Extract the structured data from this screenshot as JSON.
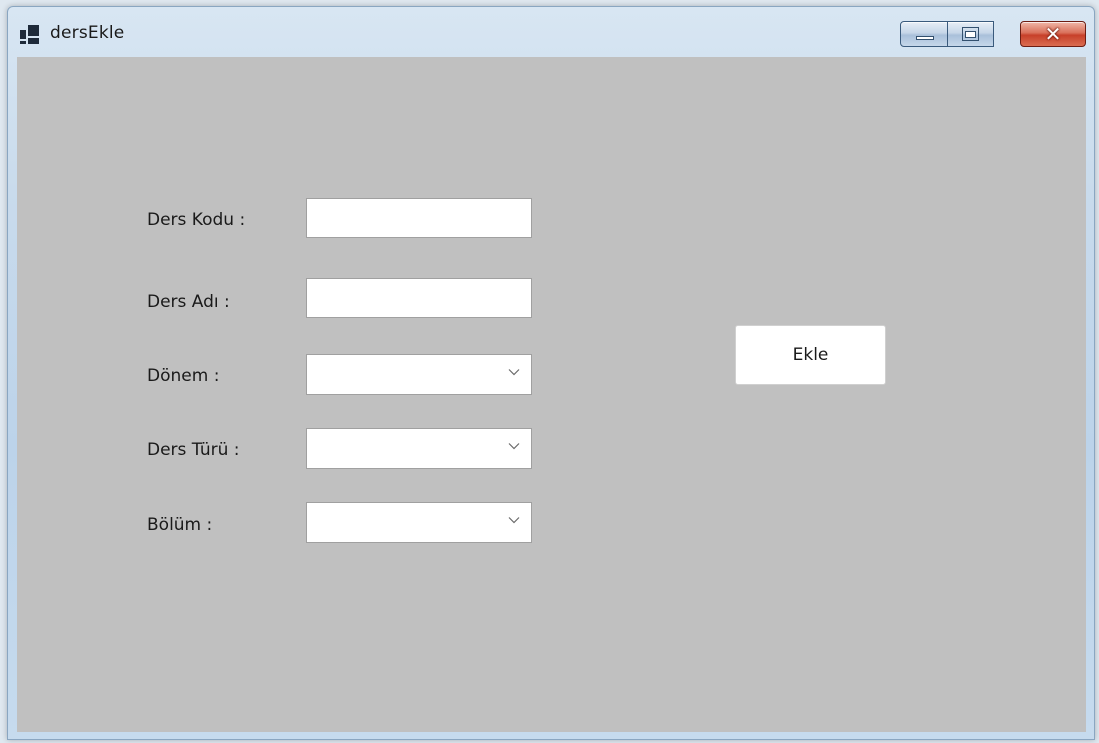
{
  "window": {
    "title": "dersEkle",
    "icon": "app-window-icon",
    "controls": {
      "minimize": "minimize-icon",
      "maximize": "maximize-icon",
      "close": "close-icon"
    }
  },
  "form": {
    "fields": [
      {
        "label": "Ders Kodu :",
        "type": "textbox",
        "value": ""
      },
      {
        "label": "Ders Adı :",
        "type": "textbox",
        "value": ""
      },
      {
        "label": "Dönem :",
        "type": "combobox",
        "value": ""
      },
      {
        "label": "Ders Türü :",
        "type": "combobox",
        "value": ""
      },
      {
        "label": "Bölüm :",
        "type": "combobox",
        "value": ""
      }
    ],
    "submit_label": "Ekle"
  },
  "colors": {
    "client_background": "#c0c0c0",
    "close_button": "#c7402a",
    "titlebar": "#c9dbec"
  }
}
